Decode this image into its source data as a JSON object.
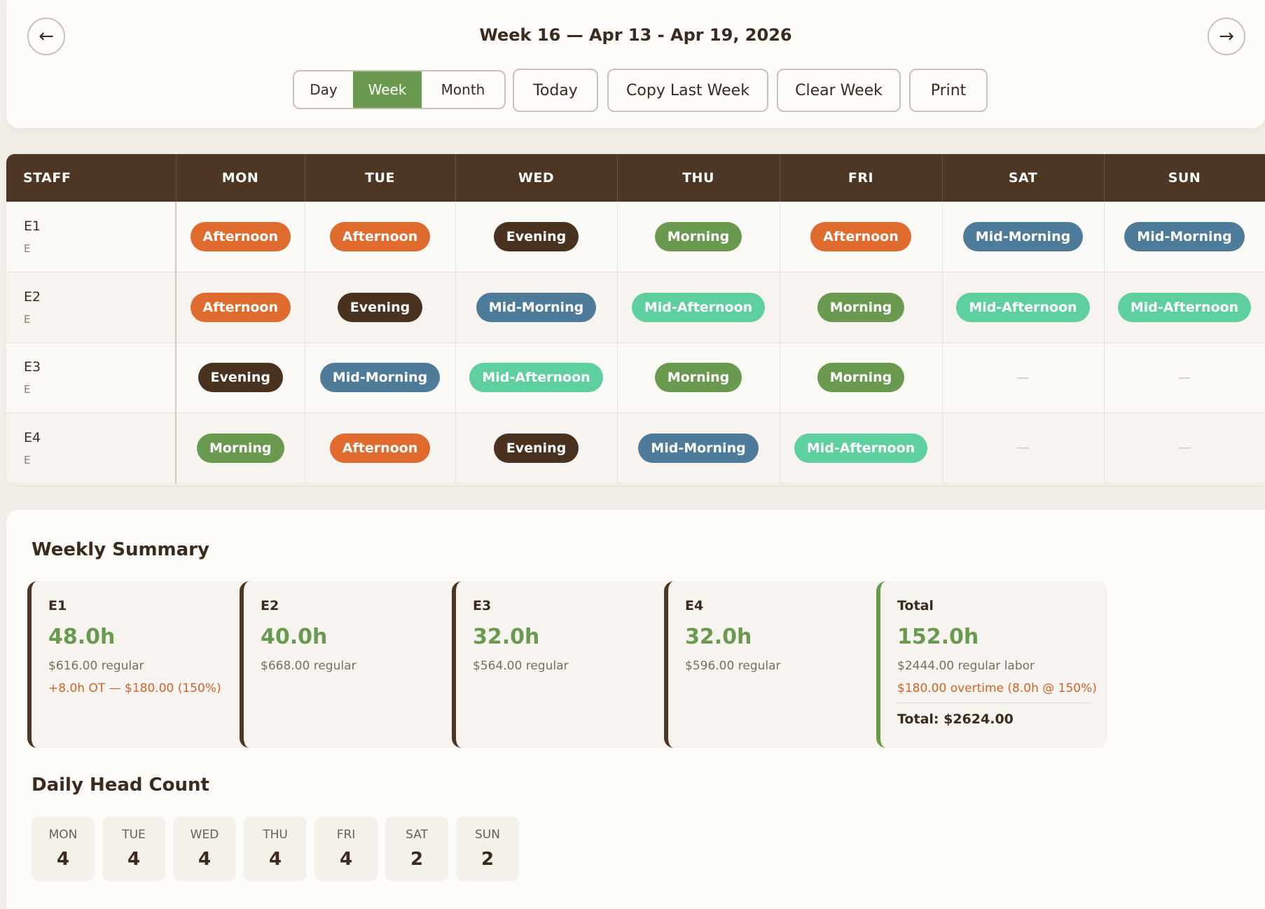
{
  "header": {
    "title": "Week 16 — Apr 13 - Apr 19, 2026",
    "prev_label": "←",
    "next_label": "→",
    "view_options": [
      "Day",
      "Week",
      "Month"
    ],
    "selected_view": "Week",
    "today_label": "Today",
    "copy_label": "Copy Last Week",
    "clear_label": "Clear Week",
    "print_label": "Print"
  },
  "schedule": {
    "staff_header": "STAFF",
    "days": [
      "MON",
      "TUE",
      "WED",
      "THU",
      "FRI",
      "SAT",
      "SUN"
    ],
    "empty_marker": "—",
    "rows": [
      {
        "name": "E1",
        "sub": "E",
        "shifts": [
          "Afternoon",
          "Afternoon",
          "Evening",
          "Morning",
          "Afternoon",
          "Mid-Morning",
          "Mid-Morning"
        ]
      },
      {
        "name": "E2",
        "sub": "E",
        "shifts": [
          "Afternoon",
          "Evening",
          "Mid-Morning",
          "Mid-Afternoon",
          "Morning",
          "Mid-Afternoon",
          "Mid-Afternoon"
        ]
      },
      {
        "name": "E3",
        "sub": "E",
        "shifts": [
          "Evening",
          "Mid-Morning",
          "Mid-Afternoon",
          "Morning",
          "Morning",
          "",
          ""
        ]
      },
      {
        "name": "E4",
        "sub": "E",
        "shifts": [
          "Morning",
          "Afternoon",
          "Evening",
          "Mid-Morning",
          "Mid-Afternoon",
          "",
          ""
        ]
      }
    ],
    "shift_colors": {
      "Afternoon": "#df6b2f",
      "Evening": "#4a3221",
      "Morning": "#6a9a4f",
      "Mid-Morning": "#4e7b9a",
      "Mid-Afternoon": "#5ecf9f"
    }
  },
  "summary": {
    "title": "Weekly Summary",
    "employees": [
      {
        "name": "E1",
        "hours": "48.0h",
        "regular": "$616.00 regular",
        "overtime": "+8.0h OT — $180.00 (150%)"
      },
      {
        "name": "E2",
        "hours": "40.0h",
        "regular": "$668.00 regular",
        "overtime": ""
      },
      {
        "name": "E3",
        "hours": "32.0h",
        "regular": "$564.00 regular",
        "overtime": ""
      },
      {
        "name": "E4",
        "hours": "32.0h",
        "regular": "$596.00 regular",
        "overtime": ""
      }
    ],
    "total": {
      "name": "Total",
      "hours": "152.0h",
      "regular": "$2444.00 regular labor",
      "overtime": "$180.00 overtime (8.0h @ 150%)",
      "grand_total": "Total: $2624.00"
    }
  },
  "head_count": {
    "title": "Daily Head Count",
    "days": [
      {
        "day": "MON",
        "count": "4"
      },
      {
        "day": "TUE",
        "count": "4"
      },
      {
        "day": "WED",
        "count": "4"
      },
      {
        "day": "THU",
        "count": "4"
      },
      {
        "day": "FRI",
        "count": "4"
      },
      {
        "day": "SAT",
        "count": "2"
      },
      {
        "day": "SUN",
        "count": "2"
      }
    ]
  }
}
